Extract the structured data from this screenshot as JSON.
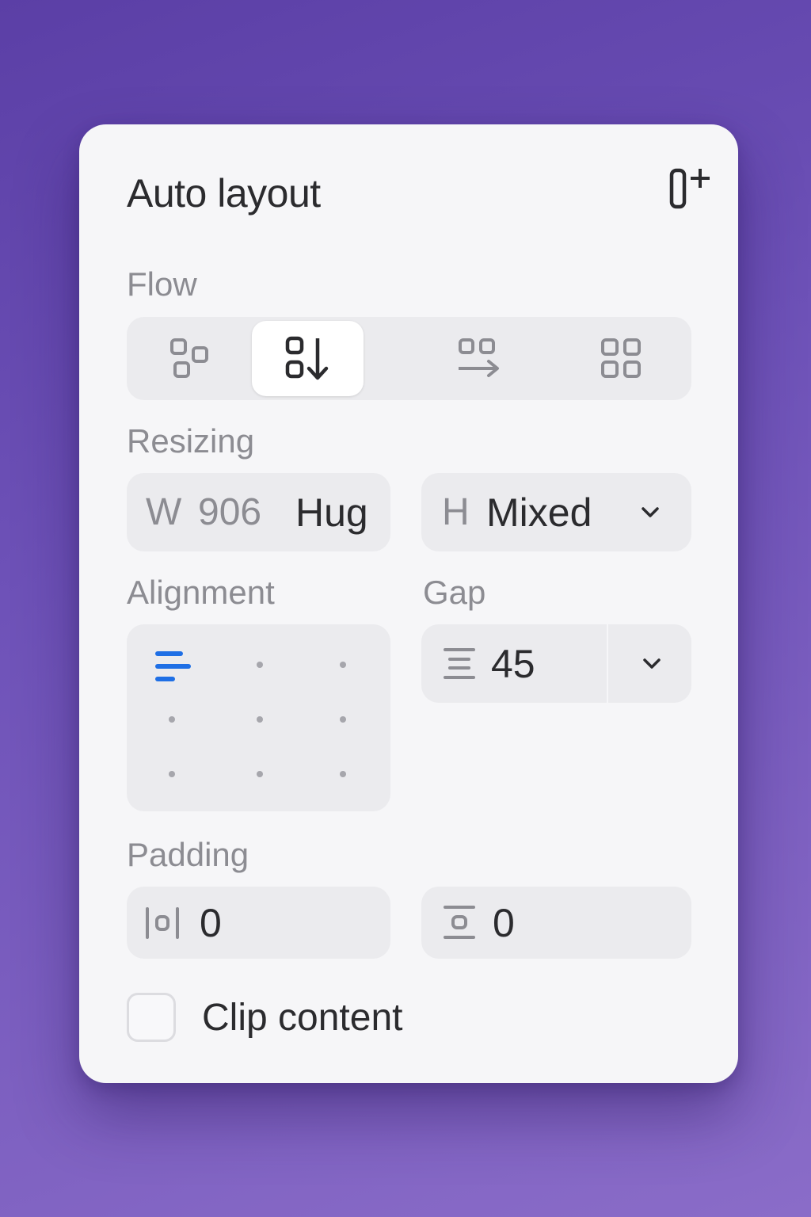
{
  "panel": {
    "title": "Auto layout",
    "add_icon": "add-auto-layout-icon"
  },
  "flow": {
    "label": "Flow",
    "options": [
      {
        "icon": "freeform-layout-icon",
        "selected": false
      },
      {
        "icon": "vertical-layout-icon",
        "selected": true
      },
      {
        "icon": "horizontal-layout-icon",
        "selected": false
      },
      {
        "icon": "grid-layout-icon",
        "selected": false
      }
    ]
  },
  "resizing": {
    "label": "Resizing",
    "width_prefix": "W",
    "width_value": "906",
    "width_mode": "Hug",
    "height_prefix": "H",
    "height_value": "Mixed"
  },
  "alignment": {
    "label": "Alignment",
    "selected": "top-left",
    "accent_color": "#1f6fe5"
  },
  "gap": {
    "label": "Gap",
    "value": "45"
  },
  "padding": {
    "label": "Padding",
    "horizontal_value": "0",
    "vertical_value": "0"
  },
  "clip_content": {
    "label": "Clip content",
    "checked": false
  }
}
